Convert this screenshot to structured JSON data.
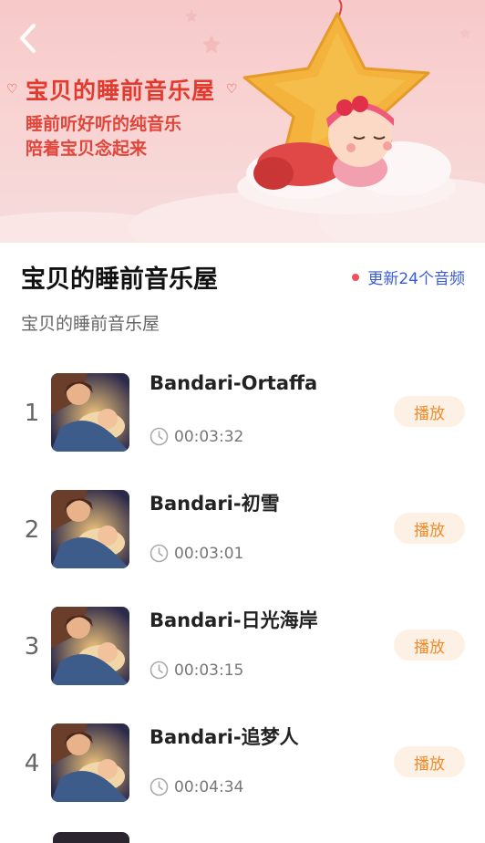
{
  "banner": {
    "title": "宝贝的睡前音乐屋",
    "line1": "睡前听好听的纯音乐",
    "line2": "陪着宝贝念起来"
  },
  "album": {
    "title": "宝贝的睡前音乐屋",
    "update_text": "更新24个音频",
    "description": "宝贝的睡前音乐屋"
  },
  "tracks": [
    {
      "num": "1",
      "name": "Bandari-Ortaffa",
      "duration": "00:03:32",
      "play_label": "播放"
    },
    {
      "num": "2",
      "name": "Bandari-初雪",
      "duration": "00:03:01",
      "play_label": "播放"
    },
    {
      "num": "3",
      "name": "Bandari-日光海岸",
      "duration": "00:03:15",
      "play_label": "播放"
    },
    {
      "num": "4",
      "name": "Bandari-追梦人",
      "duration": "00:04:34",
      "play_label": "播放"
    }
  ],
  "colors": {
    "accent_link": "#3a5bd9",
    "play_text": "#f08a2a",
    "play_bg": "#fdf0e4",
    "banner_title": "#e23a2e",
    "dot": "#f0505a"
  },
  "icons": {
    "back": "chevron-left-icon",
    "clock": "clock-icon"
  }
}
